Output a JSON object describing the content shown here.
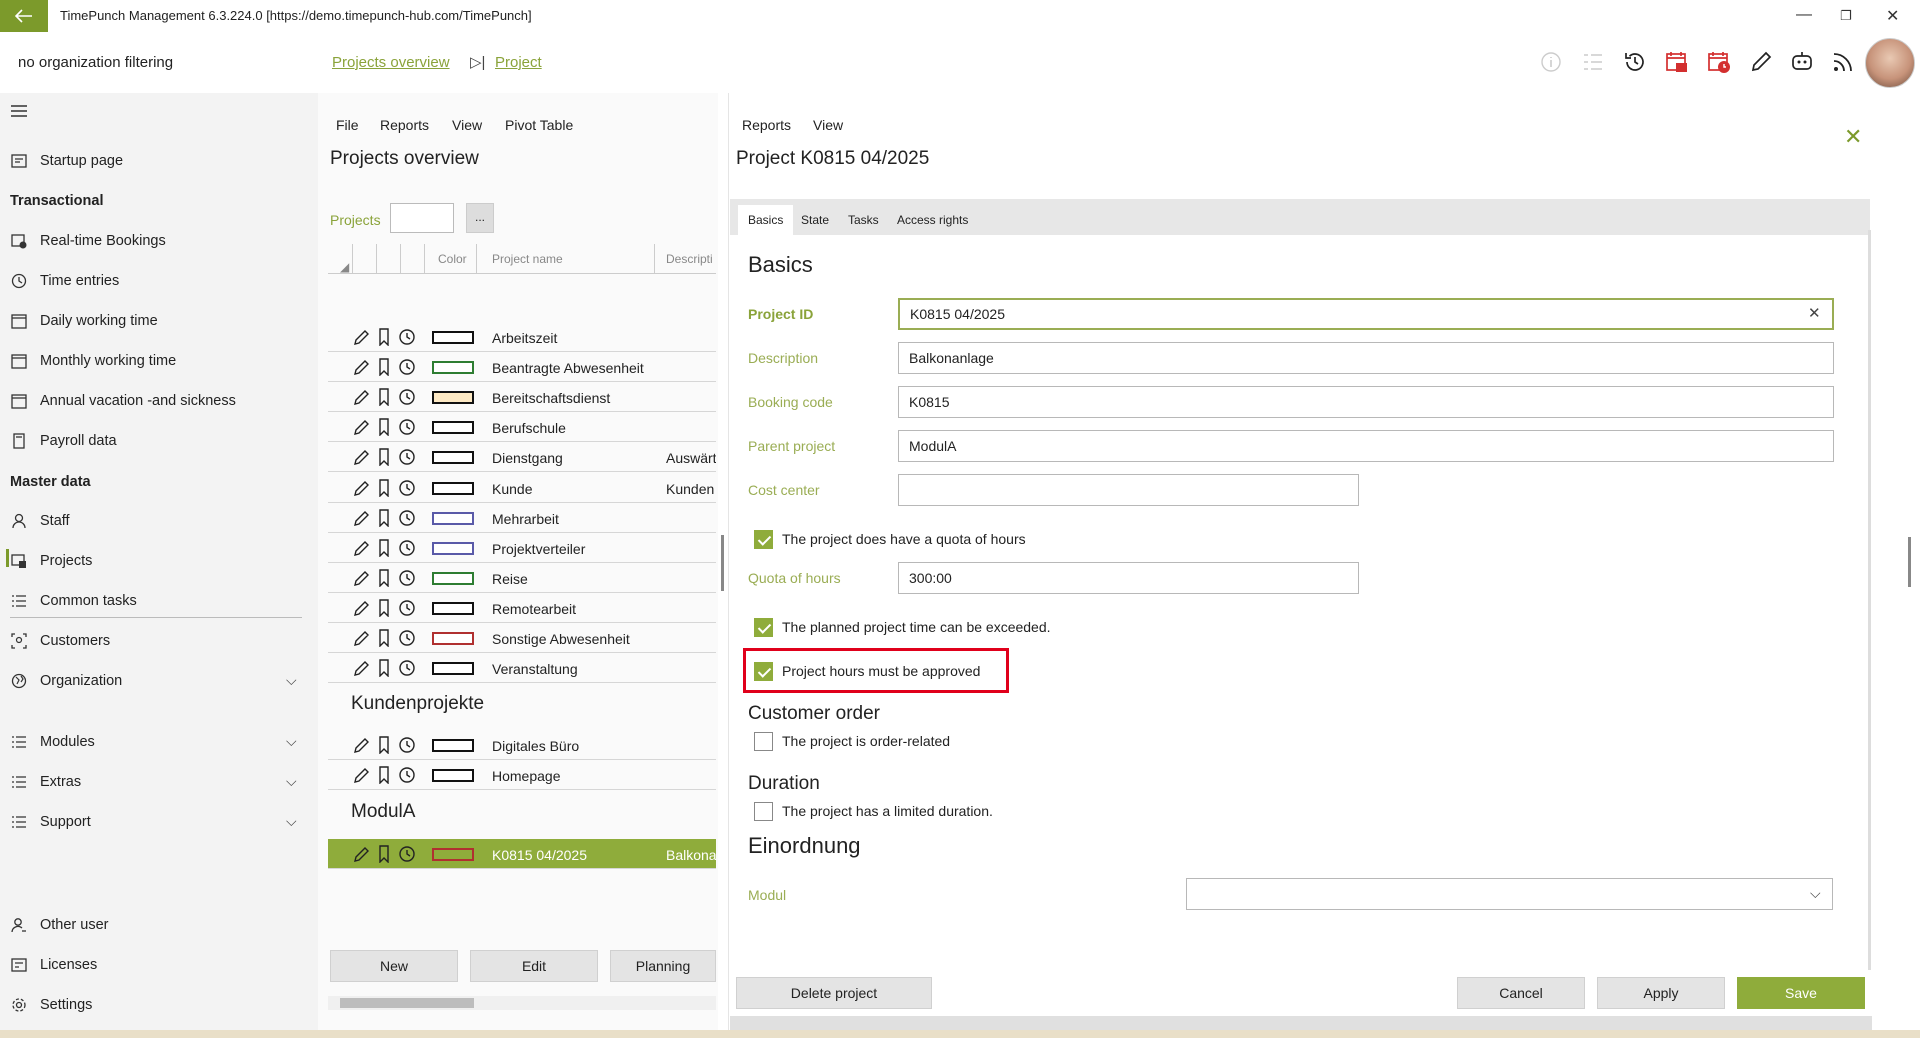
{
  "window": {
    "title": "TimePunch Management 6.3.224.0 [https://demo.timepunch-hub.com/TimePunch]",
    "back_icon": "arrow-left-icon",
    "minimize": "—",
    "restore": "❐",
    "close": "✕"
  },
  "topbar": {
    "org_filter": "no organization filtering",
    "breadcrumb": [
      "Projects overview",
      "Project"
    ],
    "crumb_sep": "▷|",
    "icons": [
      "info-icon",
      "list-icon",
      "history-icon",
      "calendar-briefcase-icon",
      "calendar-clock-icon",
      "pencil-icon",
      "robot-icon",
      "rss-icon"
    ]
  },
  "sidebar": {
    "menu_icon": "hamburger-icon",
    "startup": "Startup page",
    "transactional_head": "Transactional",
    "transactional": [
      "Real-time Bookings",
      "Time entries",
      "Daily working time",
      "Monthly working time",
      "Annual vacation -and sickness",
      "Payroll data"
    ],
    "master_head": "Master data",
    "master": [
      "Staff",
      "Projects",
      "Common tasks",
      "Customers",
      "Organization"
    ],
    "groups": [
      "Modules",
      "Extras",
      "Support"
    ],
    "bottom": [
      "Other user",
      "Licenses",
      "Settings"
    ],
    "accent": "#7c9a2b"
  },
  "overview": {
    "menu": [
      "File",
      "Reports",
      "View",
      "Pivot Table"
    ],
    "title": "Projects overview",
    "filter_label": "Projects",
    "filter_button": "...",
    "headers": [
      "Color",
      "Project name",
      "Descripti"
    ],
    "rows": [
      {
        "name": "Arbeitszeit",
        "desc": "",
        "color": "#ffffff"
      },
      {
        "name": "Beantragte Abwesenheit",
        "desc": "",
        "color": "#ffffff",
        "border": "#2e7d32"
      },
      {
        "name": "Bereitschaftsdienst",
        "desc": "",
        "color": "#fde9c4"
      },
      {
        "name": "Berufschule",
        "desc": "",
        "color": "#ffffff"
      },
      {
        "name": "Dienstgang",
        "desc": "Auswärt",
        "color": "#ffffff"
      },
      {
        "name": "Kunde",
        "desc": "Kunden",
        "color": "#ffffff"
      },
      {
        "name": "Mehrarbeit",
        "desc": "",
        "color": "#ffffff",
        "border": "#5a5aa8"
      },
      {
        "name": "Projektverteiler",
        "desc": "",
        "color": "#ffffff",
        "border": "#5a5aa8"
      },
      {
        "name": "Reise",
        "desc": "",
        "color": "#ffffff",
        "border": "#2e7d32"
      },
      {
        "name": "Remotearbeit",
        "desc": "",
        "color": "#ffffff"
      },
      {
        "name": "Sonstige Abwesenheit",
        "desc": "",
        "color": "#ffffff",
        "border": "#b03030"
      },
      {
        "name": "Veranstaltung",
        "desc": "",
        "color": "#ffffff"
      }
    ],
    "group_kunden": "Kundenprojekte",
    "kunden_rows": [
      {
        "name": "Digitales Büro",
        "desc": ""
      },
      {
        "name": "Homepage",
        "desc": ""
      }
    ],
    "group_modula": "ModulA",
    "selected_row": {
      "name": "K0815 04/2025",
      "desc": "Balkona",
      "color": "#8fac3b",
      "border": "#b03030"
    },
    "buttons": [
      "New",
      "Edit",
      "Planning"
    ]
  },
  "detail": {
    "menu": [
      "Reports",
      "View"
    ],
    "title": "Project K0815 04/2025",
    "tabs": [
      "Basics",
      "State",
      "Tasks",
      "Access rights"
    ],
    "section": "Basics",
    "fields": {
      "project_id": {
        "label": "Project ID",
        "value": "K0815 04/2025"
      },
      "description": {
        "label": "Description",
        "value": "Balkonanlage"
      },
      "booking_code": {
        "label": "Booking code",
        "value": "K0815"
      },
      "parent_project": {
        "label": "Parent project",
        "value": "ModulA"
      },
      "cost_center": {
        "label": "Cost center",
        "value": ""
      },
      "quota": {
        "label": "Quota of hours",
        "value": "300:00"
      }
    },
    "checks": {
      "quota": {
        "label": "The project does have a quota of hours",
        "checked": true
      },
      "exceed": {
        "label": "The planned project time can be exceeded.",
        "checked": true
      },
      "approve": {
        "label": "Project hours must be approved",
        "checked": true
      },
      "order": {
        "label": "The project is order-related",
        "checked": false
      },
      "duration": {
        "label": "The project has a limited duration.",
        "checked": false
      }
    },
    "customer_order_head": "Customer order",
    "duration_head": "Duration",
    "einordnung_head": "Einordnung",
    "modul_label": "Modul",
    "modul_value": "",
    "buttons": {
      "delete": "Delete project",
      "cancel": "Cancel",
      "apply": "Apply",
      "save": "Save"
    },
    "highlight_color": "#e0001b"
  }
}
